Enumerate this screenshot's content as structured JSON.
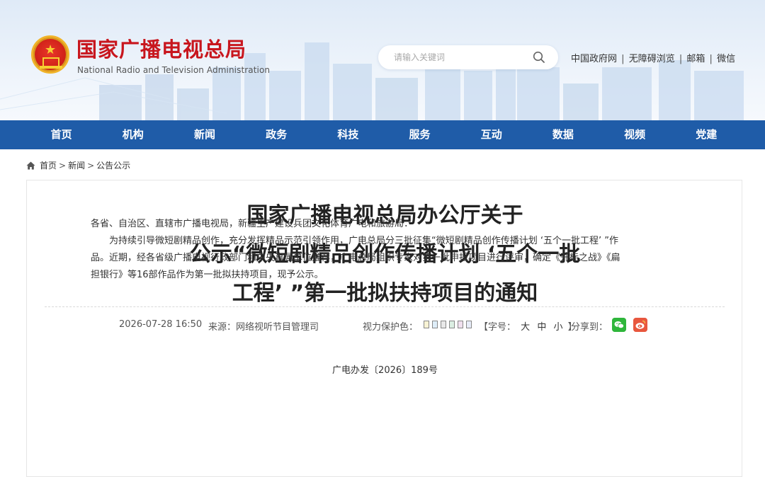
{
  "header": {
    "logo_cn": "国家广播电视总局",
    "logo_en": "National Radio and Television Administration",
    "search_placeholder": "请输入关键词",
    "toplinks": [
      "中国政府网",
      "无障碍浏览",
      "邮箱",
      "微信"
    ],
    "toplink_sep": "|"
  },
  "nav": {
    "items": [
      "首页",
      "机构",
      "新闻",
      "政务",
      "科技",
      "服务",
      "互动",
      "数据",
      "视频",
      "党建"
    ]
  },
  "breadcrumb": {
    "items": [
      "首页",
      "新闻",
      "公告公示"
    ],
    "sep": ">"
  },
  "article": {
    "title_lines": [
      "国家广播电视总局办公厅关于",
      "公示“微短剧精品创作传播计划 ‘五个一批",
      "工程’ ”第一批拟扶持项目的通知"
    ],
    "date": "2026-07-28 16:50",
    "source": "来源：网络视听节目管理司",
    "visual_protection_label": "视力保护色：",
    "swatch_colors": [
      "#f8f3d4",
      "#dfeef9",
      "#e8e8e8",
      "#dcefe3",
      "#f0e0ee",
      "#e7ecf8"
    ],
    "font_label_open": "【字号：",
    "font_sizes": [
      "大",
      "中",
      "小"
    ],
    "font_label_close": "】",
    "share_label": "分享到：",
    "share_icons": [
      "wechat-icon",
      "weibo-icon"
    ],
    "doc_number": "广电办发〔2026〕189号",
    "addressee": "各省、自治区、直辖市广播电视局，新疆生产建设兵团文化体育广电和旅游局：",
    "paragraph": "为持续引导微短剧精品创作，充分发挥精品示范引领作用，广电总局分三批征集“微短剧精品创作传播计划 ‘五个一批工程’ ”作品。近期，经各省级广播电视行政部门和中央直属单位推荐，广电总局组织专家对第一批申报项目进行评审，确定《开标之战》《扁担银行》等16部作品作为第一批拟扶持项目，现予公示。"
  },
  "colors": {
    "brand_red": "#c8161e",
    "nav_blue": "#1f5ca8"
  }
}
